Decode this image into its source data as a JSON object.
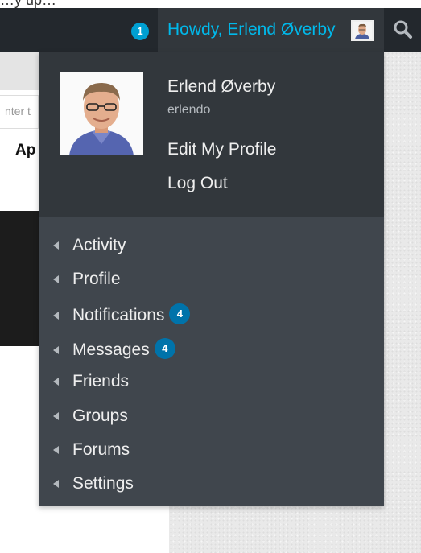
{
  "admin_bar": {
    "notification_count": "1",
    "howdy": "Howdy, Erlend Øverby",
    "search_icon": "search-icon"
  },
  "background": {
    "top_text": "…y up…",
    "input_placeholder": "nter t",
    "heading": "Ap"
  },
  "profile": {
    "display_name": "Erlend Øverby",
    "username": "erlendo",
    "edit_label": "Edit My Profile",
    "logout_label": "Log Out"
  },
  "menu": {
    "items": [
      {
        "label": "Activity",
        "count": ""
      },
      {
        "label": "Profile",
        "count": ""
      },
      {
        "label": "Notifications",
        "count": "4"
      },
      {
        "label": "Messages",
        "count": "4"
      },
      {
        "label": "Friends",
        "count": ""
      },
      {
        "label": "Groups",
        "count": ""
      },
      {
        "label": "Forums",
        "count": ""
      },
      {
        "label": "Settings",
        "count": ""
      }
    ]
  },
  "colors": {
    "admin_bar": "#23282d",
    "dropdown": "#32373c",
    "submenu": "#40464d",
    "link": "#00b9eb",
    "badge": "#0073aa",
    "bubble": "#00a0d2"
  }
}
